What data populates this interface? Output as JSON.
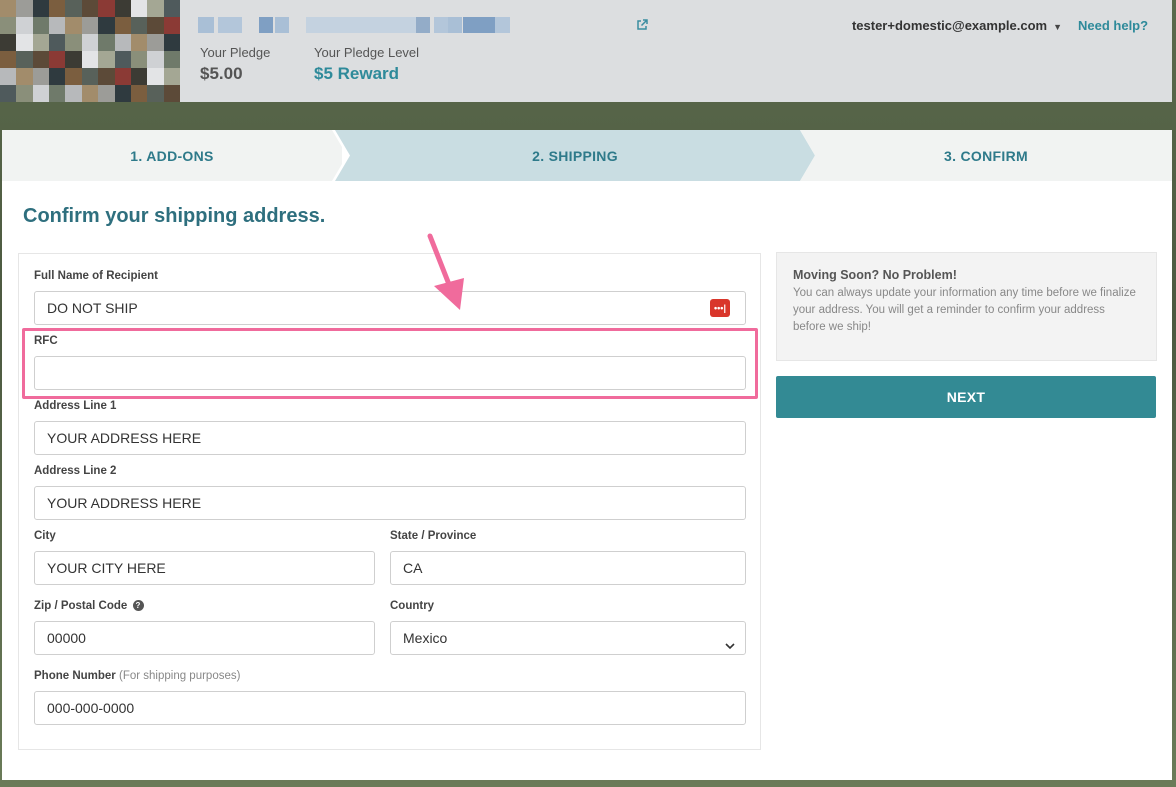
{
  "header": {
    "your_pledge_label": "Your Pledge",
    "your_pledge_value": "$5.00",
    "pledge_level_label": "Your Pledge Level",
    "pledge_level_value": "$5 Reward",
    "account_email": "tester+domestic@example.com",
    "help_link": "Need help?",
    "external_link_icon": "external-link-icon"
  },
  "steps": [
    {
      "label": "1. ADD-ONS"
    },
    {
      "label": "2. SHIPPING",
      "active": true
    },
    {
      "label": "3. CONFIRM"
    }
  ],
  "main": {
    "heading": "Confirm your shipping address."
  },
  "form": {
    "full_name": {
      "label": "Full Name of Recipient",
      "value": "DO NOT SHIP"
    },
    "rfc": {
      "label": "RFC",
      "value": ""
    },
    "address1": {
      "label": "Address Line 1",
      "value": "YOUR ADDRESS HERE"
    },
    "address2": {
      "label": "Address Line 2",
      "value": "YOUR ADDRESS HERE"
    },
    "city": {
      "label": "City",
      "value": "YOUR CITY HERE"
    },
    "state": {
      "label": "State / Province",
      "value": "CA"
    },
    "zip": {
      "label": "Zip / Postal Code",
      "value": "00000"
    },
    "country": {
      "label": "Country",
      "value": "Mexico"
    },
    "phone": {
      "label": "Phone Number",
      "hint": "(For shipping purposes)",
      "value": "000-000-0000"
    }
  },
  "sidebar": {
    "note_title": "Moving Soon? No Problem!",
    "note_body": "You can always update your information any time before we finalize your address. You will get a reminder to confirm your address before we ship!",
    "next_label": "NEXT"
  },
  "colors": {
    "accent": "#338a94",
    "highlight": "#f06b9c",
    "active_step": "#c9dde2"
  }
}
